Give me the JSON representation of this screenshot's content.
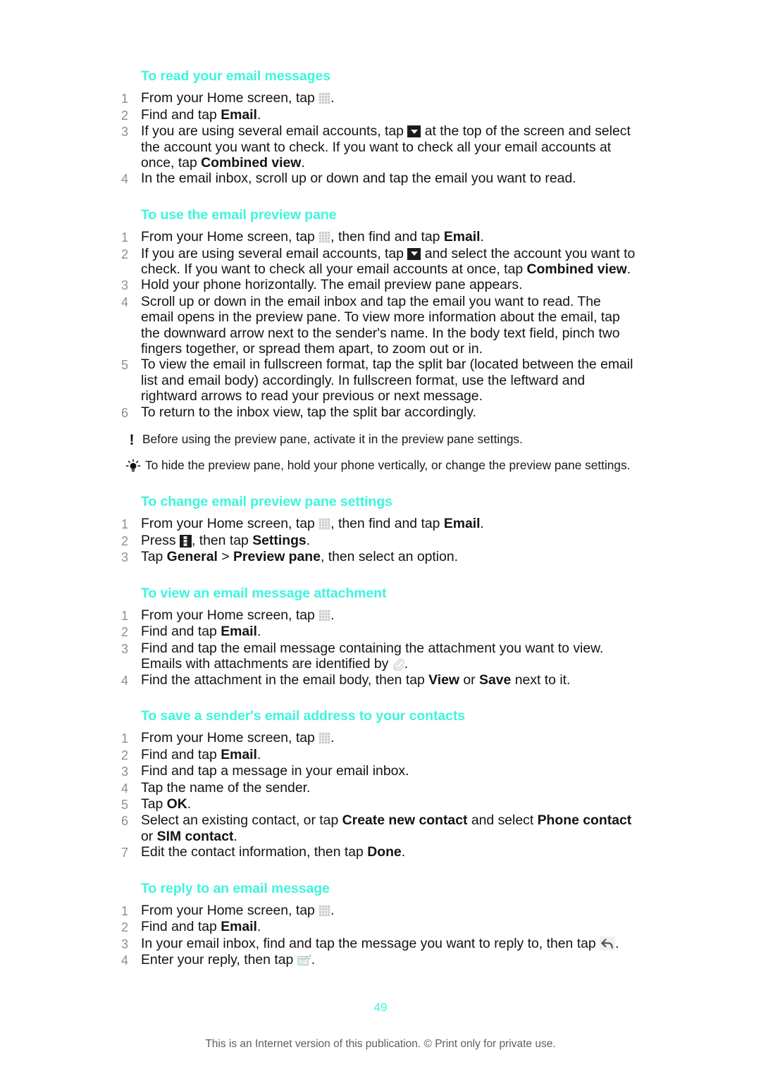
{
  "document": {
    "page_number": "49",
    "footer_note": "This is an Internet version of this publication. © Print only for private use."
  },
  "sections": [
    {
      "heading": "To read your email messages",
      "steps": [
        {
          "num": "1",
          "parts": [
            {
              "t": "text",
              "v": "From your Home screen, tap "
            },
            {
              "t": "icon",
              "v": "app-grid-icon"
            },
            {
              "t": "text",
              "v": "."
            }
          ]
        },
        {
          "num": "2",
          "parts": [
            {
              "t": "text",
              "v": "Find and tap "
            },
            {
              "t": "bold",
              "v": "Email"
            },
            {
              "t": "text",
              "v": "."
            }
          ]
        },
        {
          "num": "3",
          "parts": [
            {
              "t": "text",
              "v": "If you are using several email accounts, tap "
            },
            {
              "t": "icon",
              "v": "dropdown-icon"
            },
            {
              "t": "text",
              "v": " at the top of the screen and select the account you want to check. If you want to check all your email accounts at once, tap "
            },
            {
              "t": "bold",
              "v": "Combined view"
            },
            {
              "t": "text",
              "v": "."
            }
          ]
        },
        {
          "num": "4",
          "parts": [
            {
              "t": "text",
              "v": "In the email inbox, scroll up or down and tap the email you want to read."
            }
          ]
        }
      ],
      "callouts": []
    },
    {
      "heading": "To use the email preview pane",
      "steps": [
        {
          "num": "1",
          "parts": [
            {
              "t": "text",
              "v": "From your Home screen, tap "
            },
            {
              "t": "icon",
              "v": "app-grid-icon"
            },
            {
              "t": "text",
              "v": ", then find and tap "
            },
            {
              "t": "bold",
              "v": "Email"
            },
            {
              "t": "text",
              "v": "."
            }
          ]
        },
        {
          "num": "2",
          "parts": [
            {
              "t": "text",
              "v": "If you are using several email accounts, tap "
            },
            {
              "t": "icon",
              "v": "dropdown-icon"
            },
            {
              "t": "text",
              "v": " and select the account you want to check. If you want to check all your email accounts at once, tap "
            },
            {
              "t": "bold",
              "v": "Combined view"
            },
            {
              "t": "text",
              "v": "."
            }
          ]
        },
        {
          "num": "3",
          "parts": [
            {
              "t": "text",
              "v": "Hold your phone horizontally. The email preview pane appears."
            }
          ]
        },
        {
          "num": "4",
          "parts": [
            {
              "t": "text",
              "v": "Scroll up or down in the email inbox and tap the email you want to read. The email opens in the preview pane. To view more information about the email, tap the downward arrow next to the sender's name. In the body text field, pinch two fingers together, or spread them apart, to zoom out or in."
            }
          ]
        },
        {
          "num": "5",
          "parts": [
            {
              "t": "text",
              "v": "To view the email in fullscreen format, tap the split bar (located between the email list and email body) accordingly. In fullscreen format, use the leftward and rightward arrows to read your previous or next message."
            }
          ]
        },
        {
          "num": "6",
          "parts": [
            {
              "t": "text",
              "v": "To return to the inbox view, tap the split bar accordingly."
            }
          ]
        }
      ],
      "callouts": [
        {
          "kind": "note",
          "icon": "exclamation-icon",
          "text": "Before using the preview pane, activate it in the preview pane settings."
        },
        {
          "kind": "tip",
          "icon": "lightbulb-icon",
          "text": "To hide the preview pane, hold your phone vertically, or change the preview pane settings."
        }
      ]
    },
    {
      "heading": "To change email preview pane settings",
      "steps": [
        {
          "num": "1",
          "parts": [
            {
              "t": "text",
              "v": "From your Home screen, tap "
            },
            {
              "t": "icon",
              "v": "app-grid-icon"
            },
            {
              "t": "text",
              "v": ", then find and tap "
            },
            {
              "t": "bold",
              "v": "Email"
            },
            {
              "t": "text",
              "v": "."
            }
          ]
        },
        {
          "num": "2",
          "parts": [
            {
              "t": "text",
              "v": "Press "
            },
            {
              "t": "icon",
              "v": "overflow-menu-icon"
            },
            {
              "t": "text",
              "v": ", then tap "
            },
            {
              "t": "bold",
              "v": "Settings"
            },
            {
              "t": "text",
              "v": "."
            }
          ]
        },
        {
          "num": "3",
          "parts": [
            {
              "t": "text",
              "v": "Tap "
            },
            {
              "t": "bold",
              "v": "General"
            },
            {
              "t": "text",
              "v": " > "
            },
            {
              "t": "bold",
              "v": "Preview pane"
            },
            {
              "t": "text",
              "v": ", then select an option."
            }
          ]
        }
      ],
      "callouts": []
    },
    {
      "heading": "To view an email message attachment",
      "steps": [
        {
          "num": "1",
          "parts": [
            {
              "t": "text",
              "v": "From your Home screen, tap "
            },
            {
              "t": "icon",
              "v": "app-grid-icon"
            },
            {
              "t": "text",
              "v": "."
            }
          ]
        },
        {
          "num": "2",
          "parts": [
            {
              "t": "text",
              "v": "Find and tap "
            },
            {
              "t": "bold",
              "v": "Email"
            },
            {
              "t": "text",
              "v": "."
            }
          ]
        },
        {
          "num": "3",
          "parts": [
            {
              "t": "text",
              "v": "Find and tap the email message containing the attachment you want to view. Emails with attachments are identified by "
            },
            {
              "t": "icon",
              "v": "paperclip-icon"
            },
            {
              "t": "text",
              "v": "."
            }
          ]
        },
        {
          "num": "4",
          "parts": [
            {
              "t": "text",
              "v": "Find the attachment in the email body, then tap "
            },
            {
              "t": "bold",
              "v": "View"
            },
            {
              "t": "text",
              "v": " or "
            },
            {
              "t": "bold",
              "v": "Save"
            },
            {
              "t": "text",
              "v": " next to it."
            }
          ]
        }
      ],
      "callouts": []
    },
    {
      "heading": "To save a sender's email address to your contacts",
      "steps": [
        {
          "num": "1",
          "parts": [
            {
              "t": "text",
              "v": "From your Home screen, tap "
            },
            {
              "t": "icon",
              "v": "app-grid-icon"
            },
            {
              "t": "text",
              "v": "."
            }
          ]
        },
        {
          "num": "2",
          "parts": [
            {
              "t": "text",
              "v": "Find and tap "
            },
            {
              "t": "bold",
              "v": "Email"
            },
            {
              "t": "text",
              "v": "."
            }
          ]
        },
        {
          "num": "3",
          "parts": [
            {
              "t": "text",
              "v": "Find and tap a message in your email inbox."
            }
          ]
        },
        {
          "num": "4",
          "parts": [
            {
              "t": "text",
              "v": "Tap the name of the sender."
            }
          ]
        },
        {
          "num": "5",
          "parts": [
            {
              "t": "text",
              "v": "Tap "
            },
            {
              "t": "bold",
              "v": "OK"
            },
            {
              "t": "text",
              "v": "."
            }
          ]
        },
        {
          "num": "6",
          "parts": [
            {
              "t": "text",
              "v": "Select an existing contact, or tap "
            },
            {
              "t": "bold",
              "v": "Create new contact"
            },
            {
              "t": "text",
              "v": " and select "
            },
            {
              "t": "bold",
              "v": "Phone contact"
            },
            {
              "t": "text",
              "v": " or "
            },
            {
              "t": "bold",
              "v": "SIM contact"
            },
            {
              "t": "text",
              "v": "."
            }
          ]
        },
        {
          "num": "7",
          "parts": [
            {
              "t": "text",
              "v": "Edit the contact information, then tap "
            },
            {
              "t": "bold",
              "v": "Done"
            },
            {
              "t": "text",
              "v": "."
            }
          ]
        }
      ],
      "callouts": []
    },
    {
      "heading": "To reply to an email message",
      "steps": [
        {
          "num": "1",
          "parts": [
            {
              "t": "text",
              "v": "From your Home screen, tap "
            },
            {
              "t": "icon",
              "v": "app-grid-icon"
            },
            {
              "t": "text",
              "v": "."
            }
          ]
        },
        {
          "num": "2",
          "parts": [
            {
              "t": "text",
              "v": "Find and tap "
            },
            {
              "t": "bold",
              "v": "Email"
            },
            {
              "t": "text",
              "v": "."
            }
          ]
        },
        {
          "num": "3",
          "parts": [
            {
              "t": "text",
              "v": "In your email inbox, find and tap the message you want to reply to, then tap "
            },
            {
              "t": "icon",
              "v": "reply-icon"
            },
            {
              "t": "text",
              "v": "."
            }
          ]
        },
        {
          "num": "4",
          "parts": [
            {
              "t": "text",
              "v": "Enter your reply, then tap "
            },
            {
              "t": "icon",
              "v": "send-icon"
            },
            {
              "t": "text",
              "v": "."
            }
          ]
        }
      ],
      "callouts": []
    }
  ],
  "colors": {
    "heading": "#3ef5dc",
    "step_number": "#8e8e8e",
    "body_text": "#141414",
    "footer": "#5f5f5f"
  }
}
